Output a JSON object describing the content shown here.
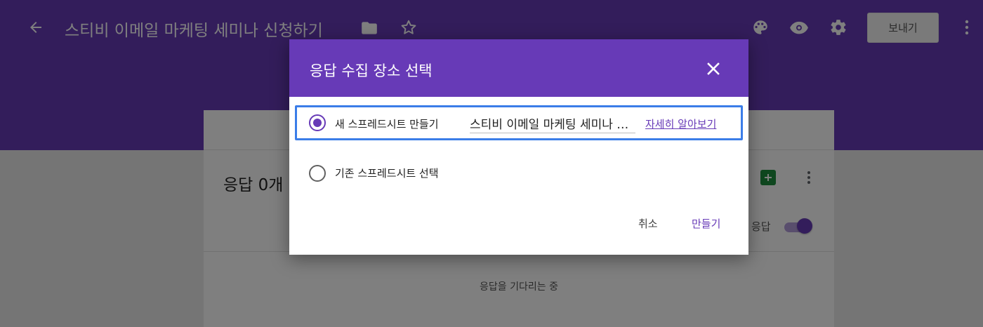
{
  "header": {
    "form_title": "스티비 이메일 마케팅 세미나 신청하기",
    "send_label": "보내기"
  },
  "responses": {
    "count_label": "응답 0개",
    "accept_label": "응답 받기",
    "waiting_text": "응답을 기다리는 중"
  },
  "dialog": {
    "title": "응답 수집 장소 선택",
    "option_new_label": "새 스프레드시트 만들기",
    "sheet_name": "스티비 이메일 마케팅 세미나 신청하기 (응답)",
    "learn_more": "자세히 알아보기",
    "option_existing_label": "기존 스프레드시트 선택",
    "cancel_label": "취소",
    "create_label": "만들기"
  },
  "colors": {
    "accent": "#673ab7",
    "focus_outline": "#3b7de8",
    "sheets_green": "#1e8e3e"
  }
}
